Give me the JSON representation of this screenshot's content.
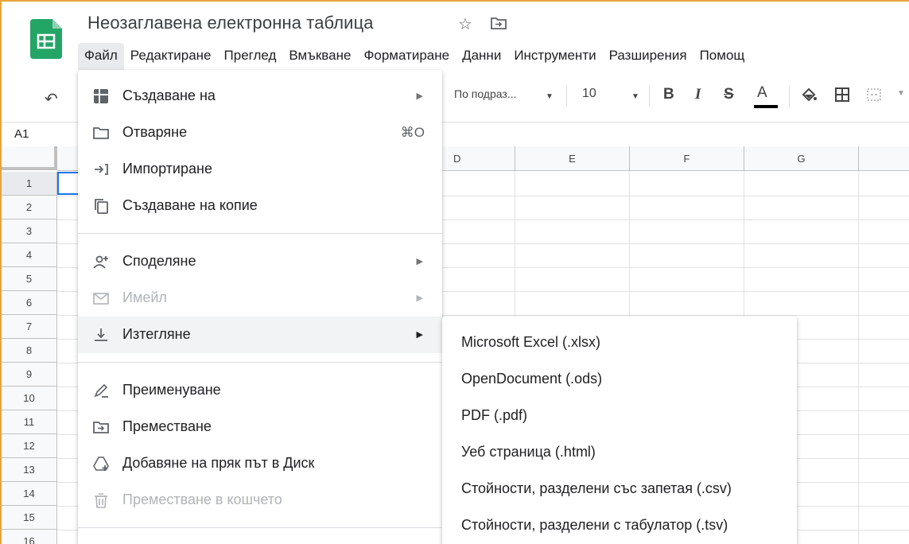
{
  "header": {
    "title": "Неозаглавена електронна таблица",
    "star_icon": "star-icon",
    "move_icon": "folder-move-icon"
  },
  "menubar": [
    "Файл",
    "Редактиране",
    "Преглед",
    "Вмъкване",
    "Форматиране",
    "Данни",
    "Инструменти",
    "Разширения",
    "Помощ"
  ],
  "toolbar": {
    "font": "По подраз...",
    "font_size": "10",
    "bold": "B",
    "italic": "I",
    "strike": "S",
    "text_color": "A"
  },
  "formula_bar": {
    "cell_ref": "A1"
  },
  "grid": {
    "columns": [
      "D",
      "E",
      "F",
      "G"
    ],
    "rows": [
      "1",
      "2",
      "3",
      "4",
      "5",
      "6",
      "7",
      "8",
      "9",
      "10",
      "11",
      "12",
      "13",
      "14",
      "15",
      "16"
    ]
  },
  "file_menu": {
    "items": [
      {
        "label": "Създаване на",
        "icon": "new-sheet-icon",
        "has_submenu": true
      },
      {
        "label": "Отваряне",
        "icon": "folder-icon",
        "shortcut": "⌘O"
      },
      {
        "label": "Импортиране",
        "icon": "import-icon"
      },
      {
        "label": "Създаване на копие",
        "icon": "copy-icon"
      },
      {
        "label": "Споделяне",
        "icon": "share-person-icon",
        "has_submenu": true
      },
      {
        "label": "Имейл",
        "icon": "mail-icon",
        "has_submenu": true,
        "disabled": true
      },
      {
        "label": "Изтегляне",
        "icon": "download-icon",
        "has_submenu": true,
        "highlighted": true
      },
      {
        "label": "Преименуване",
        "icon": "rename-icon"
      },
      {
        "label": "Преместване",
        "icon": "move-folder-icon"
      },
      {
        "label": "Добавяне на пряк път в Диск",
        "icon": "drive-shortcut-icon"
      },
      {
        "label": "Преместване в кошчето",
        "icon": "trash-icon",
        "disabled": true
      }
    ]
  },
  "download_submenu": {
    "items": [
      "Microsoft Excel (.xlsx)",
      "OpenDocument (.ods)",
      "PDF (.pdf)",
      "Уеб страница (.html)",
      "Стойности, разделени със запетая (.csv)",
      "Стойности, разделени с табулатор (.tsv)"
    ]
  },
  "colors": {
    "sheets_green": "#23a566",
    "selection_blue": "#1a73e8",
    "window_accent": "#e8a33d"
  }
}
